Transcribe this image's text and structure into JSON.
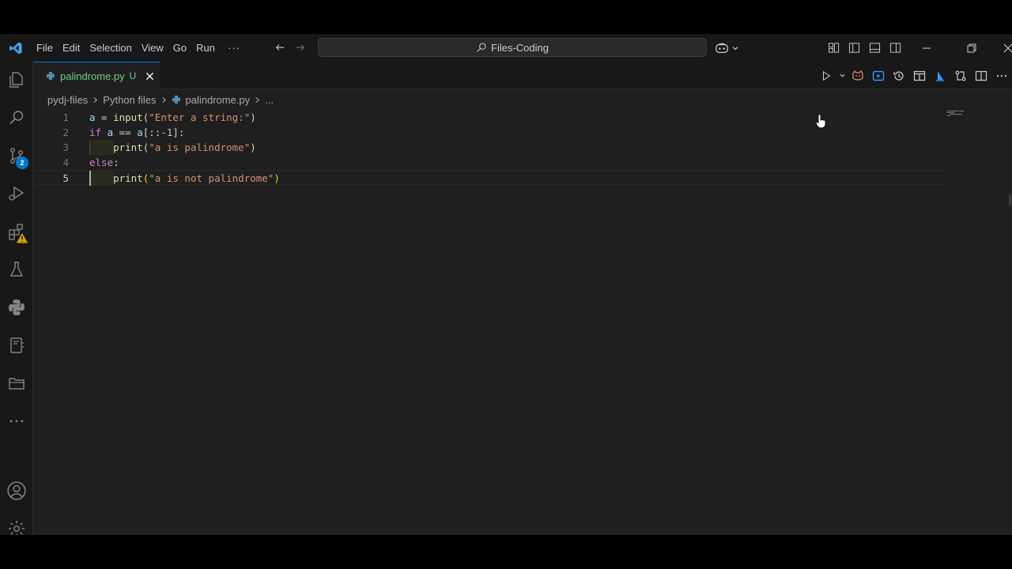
{
  "menu": [
    "File",
    "Edit",
    "Selection",
    "View",
    "Go",
    "Run"
  ],
  "menu_more": "···",
  "search": {
    "text": "Files-Coding"
  },
  "tab": {
    "filename": "palindrome.py",
    "status": "U"
  },
  "breadcrumb": {
    "root": "pydj-files",
    "folder": "Python files",
    "file": "palindrome.py",
    "more": "..."
  },
  "editor": {
    "current_line": 5,
    "lines": [
      {
        "n": "1",
        "tokens": [
          [
            "var",
            "a"
          ],
          [
            "op",
            " = "
          ],
          [
            "fn",
            "input"
          ],
          [
            "op",
            "("
          ],
          [
            "str",
            "\"Enter a string:\""
          ],
          [
            "op",
            ")"
          ]
        ]
      },
      {
        "n": "2",
        "tokens": [
          [
            "kw",
            "if"
          ],
          [
            "op",
            " "
          ],
          [
            "var",
            "a"
          ],
          [
            "op",
            " == "
          ],
          [
            "var",
            "a"
          ],
          [
            "op",
            "[::"
          ],
          [
            "num",
            "-1"
          ],
          [
            "op",
            "]:"
          ]
        ]
      },
      {
        "n": "3",
        "tokens": [
          [
            "op",
            "    "
          ],
          [
            "fn",
            "print"
          ],
          [
            "op",
            "("
          ],
          [
            "str",
            "\"a is palindrome\""
          ],
          [
            "op",
            ")"
          ]
        ]
      },
      {
        "n": "4",
        "tokens": [
          [
            "kw",
            "else"
          ],
          [
            "op",
            ":"
          ]
        ]
      },
      {
        "n": "5",
        "tokens": [
          [
            "op",
            "    "
          ],
          [
            "fn",
            "print"
          ],
          [
            "br",
            "("
          ],
          [
            "str",
            "\"a is not palindrome\""
          ],
          [
            "br",
            ")"
          ]
        ]
      }
    ]
  },
  "activity": {
    "source_control_badge": "2"
  },
  "colors": {
    "accent": "#0078d4",
    "untracked": "#73c991",
    "editor_bg": "#1f1f1f",
    "chrome_bg": "#181818"
  }
}
